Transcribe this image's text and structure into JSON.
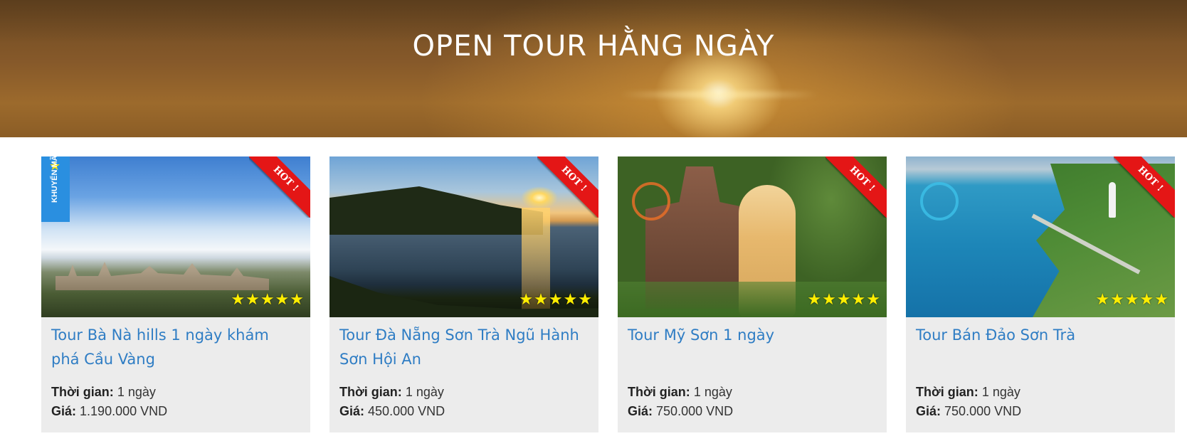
{
  "section": {
    "title": "OPEN TOUR HẰNG NGÀY"
  },
  "badges": {
    "hot": "HOT !",
    "promo": "KHUYẾN MÃI"
  },
  "labels": {
    "duration": "Thời gian:",
    "price": "Giá:"
  },
  "tours": [
    {
      "title": "Tour Bà Nà hills 1 ngày khám phá Cầu Vàng",
      "duration": "1 ngày",
      "price": "1.190.000 VND",
      "rating": 5,
      "stars": "★★★★★"
    },
    {
      "title": "Tour Đà Nẵng Sơn Trà Ngũ Hành Sơn Hội An",
      "duration": "1 ngày",
      "price": "450.000 VND",
      "rating": 5,
      "stars": "★★★★★"
    },
    {
      "title": "Tour Mỹ Sơn 1 ngày",
      "duration": "1 ngày",
      "price": "750.000 VND",
      "rating": 5,
      "stars": "★★★★★"
    },
    {
      "title": "Tour Bán Đảo Sơn Trà",
      "duration": "1 ngày",
      "price": "750.000 VND",
      "rating": 5,
      "stars": "★★★★★"
    }
  ],
  "colors": {
    "title_link": "#2f7dc4",
    "card_bg": "#ececec",
    "hot_ribbon": "#e41616",
    "star": "#ffee00",
    "promo_tag": "#2a8fe0"
  },
  "icons": {
    "rating": "star-icon",
    "promo": "star-icon"
  }
}
